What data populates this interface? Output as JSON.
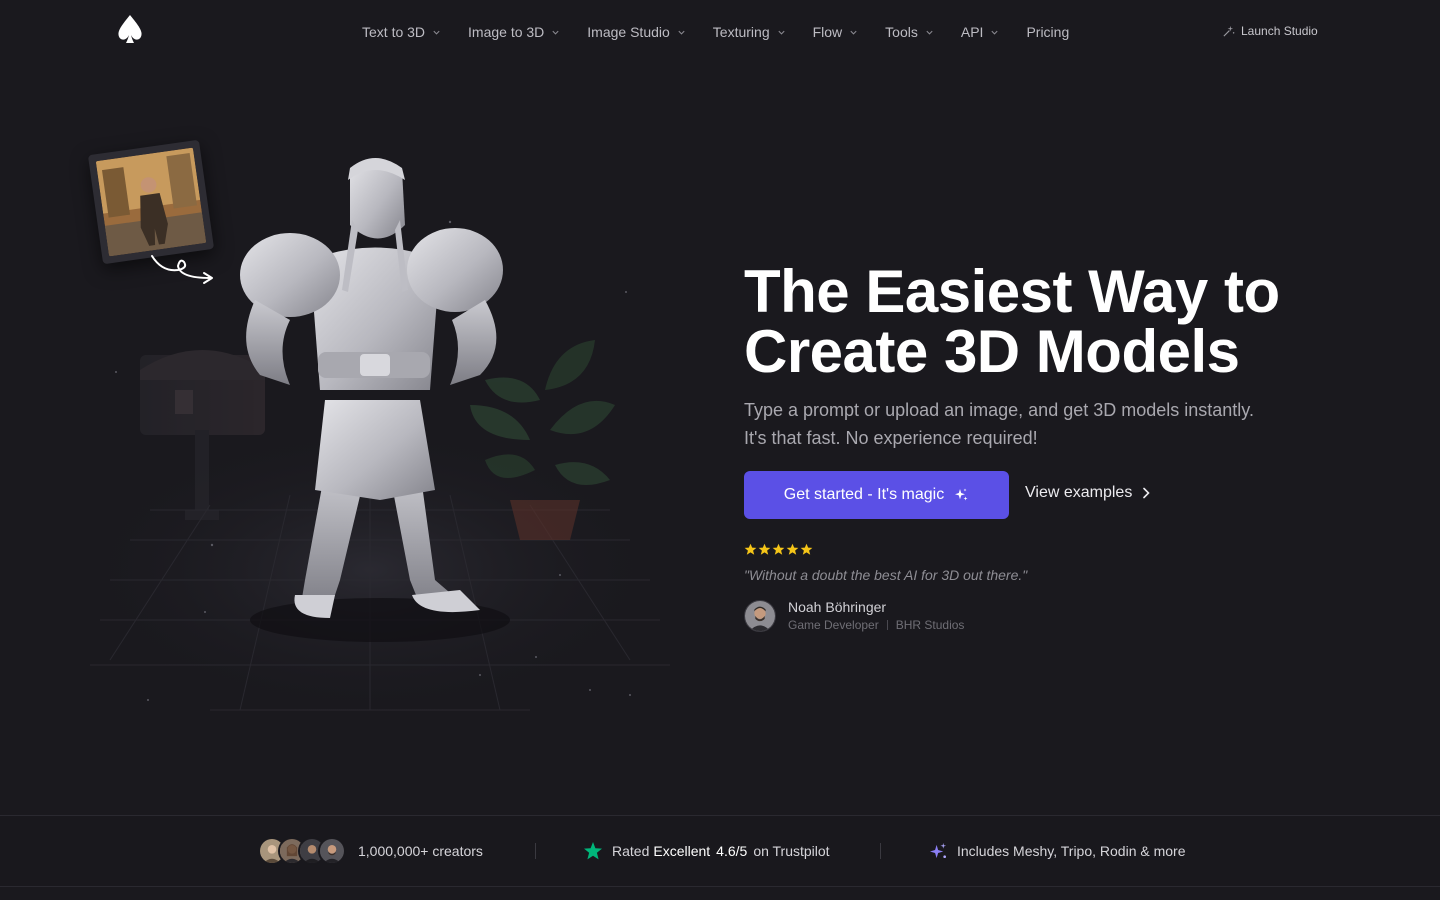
{
  "nav": {
    "items": [
      {
        "label": "Text to 3D",
        "dropdown": true
      },
      {
        "label": "Image to 3D",
        "dropdown": true
      },
      {
        "label": "Image Studio",
        "dropdown": true
      },
      {
        "label": "Texturing",
        "dropdown": true
      },
      {
        "label": "Flow",
        "dropdown": true
      },
      {
        "label": "Tools",
        "dropdown": true
      },
      {
        "label": "API",
        "dropdown": true
      },
      {
        "label": "Pricing",
        "dropdown": false
      }
    ],
    "launch_label": "Launch Studio"
  },
  "hero": {
    "headline_line1": "The Easiest Way to",
    "headline_line2": "Create 3D Models",
    "subtitle_line1": "Type a prompt or upload an image, and get 3D models instantly.",
    "subtitle_line2": "It's that fast. No experience required!",
    "cta_primary": "Get started - It's magic",
    "cta_secondary": "View examples",
    "rating_stars": 5,
    "quote": "\"Without a doubt the best AI for 3D out there.\"",
    "reviewer": {
      "name": "Noah Böhringer",
      "role": "Game Developer",
      "company": "BHR Studios"
    }
  },
  "stats": {
    "creators": "1,000,000+ creators",
    "rating_prefix": "Rated",
    "rating_word": "Excellent",
    "rating_value": "4.6/5",
    "rating_suffix": "on Trustpilot",
    "includes": "Includes Meshy, Tripo, Rodin & more"
  },
  "colors": {
    "background": "#1a191e",
    "accent": "#5b50e6",
    "star": "#f5c518",
    "trustpilot": "#00b67a"
  }
}
